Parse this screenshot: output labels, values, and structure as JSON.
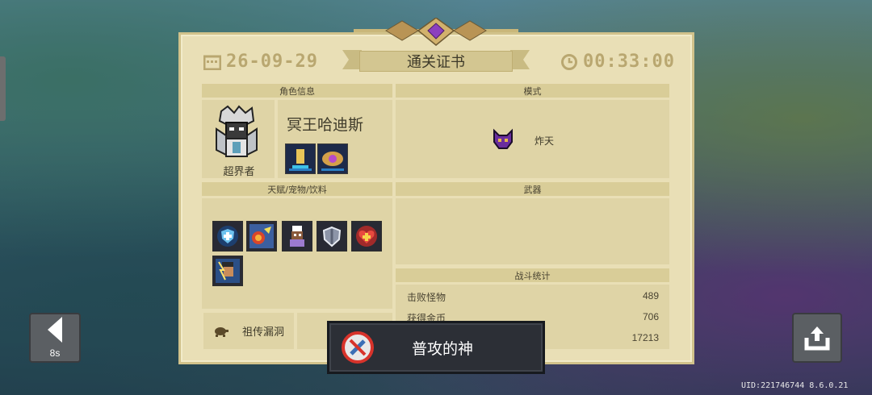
{
  "certificate": {
    "title": "通关证书",
    "date": "26-09-29",
    "time": "00:33:00"
  },
  "sections": {
    "character_info": "角色信息",
    "mode": "模式",
    "talents": "天赋/宠物/饮料",
    "weapon": "武器",
    "battle_stats": "战斗统计"
  },
  "character": {
    "name": "冥王哈迪斯",
    "class_label": "超界者",
    "icon": "hades-knight-sprite"
  },
  "mode": {
    "label": "炸天",
    "icon": "purple-demon-skull-icon"
  },
  "talents": [
    "shield-buff-icon",
    "fire-blast-icon",
    "chef-pet-icon",
    "armor-shield-icon",
    "heart-plus-icon",
    "lightning-hero-icon"
  ],
  "stats": [
    {
      "label": "击败怪物",
      "value": "489"
    },
    {
      "label": "获得金币",
      "value": "706"
    },
    {
      "label": "",
      "value": "17213"
    }
  ],
  "heirloom": {
    "label": "祖传漏洞",
    "icon": "turtle-icon"
  },
  "achievement": {
    "label": "普攻的神",
    "icon": "no-attack-icon"
  },
  "controls": {
    "back_count": "8s"
  },
  "footer": {
    "uid": "UID:221746744 8.6.0.21"
  },
  "colors": {
    "parchment": "#e9dfb6",
    "header": "#d9cd98",
    "gold_text": "#b9a770",
    "achievement_bg": "#2c2f36"
  }
}
